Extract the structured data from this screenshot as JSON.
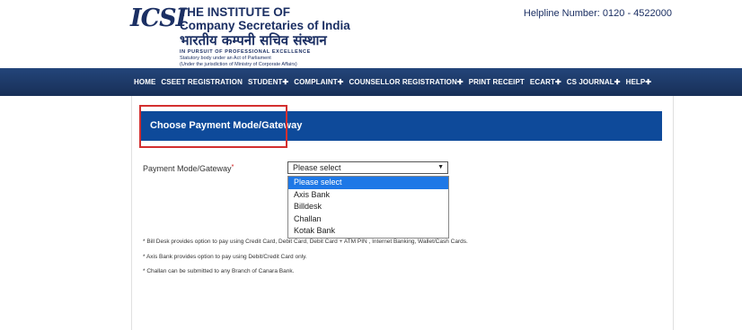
{
  "header": {
    "logo_text": "ICSI",
    "brand": {
      "line1": "THE INSTITUTE OF",
      "line2": "Company Secretaries of India",
      "hindi": "भारतीय कम्पनी सचिव संस्थान",
      "tagline": "IN PURSUIT OF PROFESSIONAL EXCELLENCE",
      "statutory": "Statutory body under an Act of Parliament",
      "jurisdiction": "(Under the jurisdiction of Ministry of Corporate Affairs)"
    },
    "helpline_label": "Helpline Number:",
    "helpline_number": "0120 - 4522000"
  },
  "nav": {
    "items": [
      "HOME",
      "CSEET REGISTRATION",
      "STUDENT✚",
      "COMPLAINT✚",
      "COUNSELLOR REGISTRATION✚",
      "PRINT RECEIPT",
      "ECART✚",
      "CS JOURNAL✚",
      "HELP✚"
    ]
  },
  "panel": {
    "title": "Choose Payment Mode/Gateway"
  },
  "form": {
    "label": "Payment Mode/Gateway",
    "required_mark": "*",
    "selected_value": "Please select",
    "arrow": "▼",
    "options": [
      "Please select",
      "Axis Bank",
      "Billdesk",
      "Challan",
      "Kotak Bank"
    ]
  },
  "notes": {
    "note1": "* Bill Desk provides option to pay using Credit Card, Debit Card, Debit Card + ATM PIN , Internet Banking, Wallet/Cash Cards.",
    "note2": "* Axis Bank provides option to pay using Debit/Credit Card only.",
    "note3": "* Challan can be submitted to any Branch of Canara Bank."
  },
  "colors": {
    "nav_bg": "#1f3d6e",
    "panel_bg": "#0e4a9a",
    "highlight_border": "#d32f2f",
    "option_selected": "#1e78e6",
    "brand_text": "#1b2f63"
  }
}
